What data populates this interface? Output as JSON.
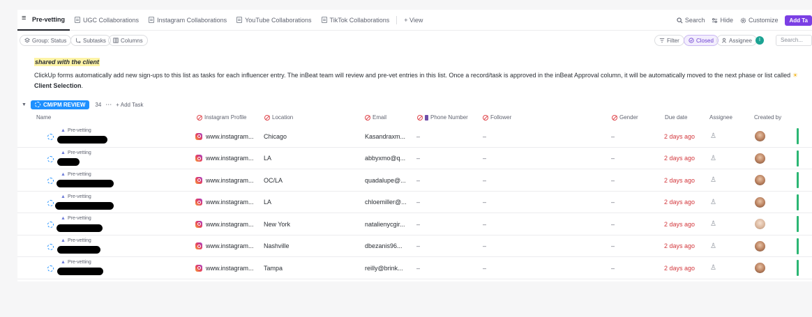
{
  "tabs": [
    {
      "label": "Pre-vetting",
      "active": true
    },
    {
      "label": "UGC Collaborations"
    },
    {
      "label": "Instagram Collaborations"
    },
    {
      "label": "YouTube Collaborations"
    },
    {
      "label": "TikTok Collaborations"
    }
  ],
  "add_view": "+ View",
  "top_right": {
    "search": "Search",
    "hide": "Hide",
    "customize": "Customize",
    "add_task": "Add Ta"
  },
  "toolbar": {
    "group": "Group: Status",
    "subtasks": "Subtasks",
    "columns": "Columns",
    "filter": "Filter",
    "closed": "Closed",
    "assignee": "Assignee",
    "avatar_letter": "I",
    "search_placeholder": "Search..."
  },
  "description": {
    "title": "shared with the client",
    "body": "ClickUp forms automatically add new sign-ups to this list as tasks for each influencer entry. The inBeat team will review and pre-vet entries in this list. Once a record/task is approved in the inBeat Approval column, it will be automatically moved to the next phase or list called",
    "sun": "☀",
    "link": "Client Selection",
    "end": "."
  },
  "group": {
    "status": "CM/PM REVIEW",
    "count": "34",
    "more": "⋯",
    "add": "+ Add Task"
  },
  "columns": {
    "name": "Name",
    "instagram": "Instagram Profile",
    "location": "Location",
    "email": "Email",
    "phone": "Phone Number",
    "follower": "Follower",
    "gender": "Gender",
    "due": "Due date",
    "assignee": "Assignee",
    "created": "Created by"
  },
  "rows": [
    {
      "parent": "Pre-vetting",
      "instagram": "www.instagram...",
      "location": "Chicago",
      "email": "Kasandraxm...",
      "phone": "–",
      "follower": "–",
      "gender": "–",
      "due": "2 days ago"
    },
    {
      "parent": "Pre-vetting",
      "instagram": "www.instagram...",
      "location": "LA",
      "email": "abbyxmo@q...",
      "phone": "–",
      "follower": "–",
      "gender": "–",
      "due": "2 days ago"
    },
    {
      "parent": "Pre-vetting",
      "instagram": "www.instagram...",
      "location": "OC/LA",
      "email": "quadalupe@...",
      "phone": "–",
      "follower": "–",
      "gender": "–",
      "due": "2 days ago"
    },
    {
      "parent": "Pre-vetting",
      "instagram": "www.instagram...",
      "location": "LA",
      "email": "chloemiller@...",
      "phone": "–",
      "follower": "–",
      "gender": "–",
      "due": "2 days ago"
    },
    {
      "parent": "Pre-vetting",
      "instagram": "www.instagram...",
      "location": "New York",
      "email": "natalienycgir...",
      "phone": "–",
      "follower": "–",
      "gender": "–",
      "due": "2 days ago"
    },
    {
      "parent": "Pre-vetting",
      "instagram": "www.instagram...",
      "location": "Nashville",
      "email": "dbezanis96...",
      "phone": "–",
      "follower": "–",
      "gender": "–",
      "due": "2 days ago"
    },
    {
      "parent": "Pre-vetting",
      "instagram": "www.instagram...",
      "location": "Tampa",
      "email": "reilly@brink...",
      "phone": "–",
      "follower": "–",
      "gender": "–",
      "due": "2 days ago"
    }
  ],
  "colors": {
    "accent": "#7b3fe4",
    "status": "#1e90ff",
    "due": "#d3383d",
    "green": "#2bb673"
  },
  "icons": [
    "list-icon",
    "doc-icon",
    "search-icon",
    "hide-icon",
    "gear-icon",
    "layers-icon",
    "subtask-icon",
    "columns-icon",
    "filter-icon",
    "check-circle-icon",
    "assignee-icon",
    "ban-icon",
    "instagram-icon",
    "phone-icon",
    "person-icon"
  ]
}
